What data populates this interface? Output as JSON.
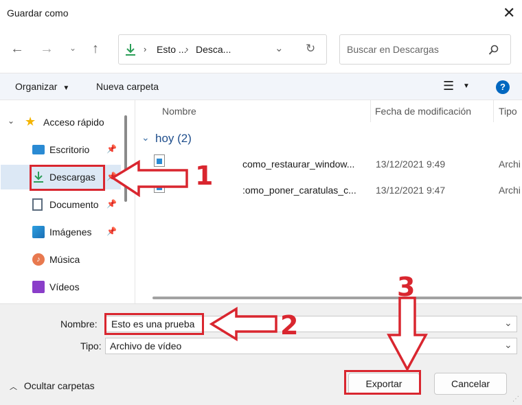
{
  "window": {
    "title": "Guardar como"
  },
  "nav": {
    "breadcrumb": [
      "Esto ...",
      "Desca..."
    ],
    "search_placeholder": "Buscar en Descargas"
  },
  "toolbar": {
    "organize_label": "Organizar",
    "new_folder_label": "Nueva carpeta"
  },
  "sidebar": {
    "items": [
      {
        "label": "Acceso rápido"
      },
      {
        "label": "Escritorio"
      },
      {
        "label": "Descargas"
      },
      {
        "label": "Documento"
      },
      {
        "label": "Imágenes"
      },
      {
        "label": "Música"
      },
      {
        "label": "Vídeos"
      }
    ]
  },
  "files": {
    "columns": [
      "Nombre",
      "Fecha de modificación",
      "Tipo"
    ],
    "group_label": "hoy (2)",
    "rows": [
      {
        "name": "como_restaurar_window...",
        "date": "13/12/2021 9:49",
        "type": "Archi"
      },
      {
        "name": ":omo_poner_caratulas_c...",
        "date": "13/12/2021 9:47",
        "type": "Archi"
      }
    ]
  },
  "form": {
    "name_label": "Nombre:",
    "name_value": "Esto es una prueba",
    "type_label": "Tipo:",
    "type_value": "Archivo de vídeo"
  },
  "footer": {
    "hide_folders_label": "Ocultar carpetas",
    "export_label": "Exportar",
    "cancel_label": "Cancelar"
  },
  "callouts": {
    "one": "1",
    "two": "2",
    "three": "3"
  },
  "colors": {
    "accent": "#0067c0",
    "callout_red": "#d9262f",
    "selection": "#dce8f5",
    "download_green": "#2a9d57",
    "star_yellow": "#f4b400"
  }
}
